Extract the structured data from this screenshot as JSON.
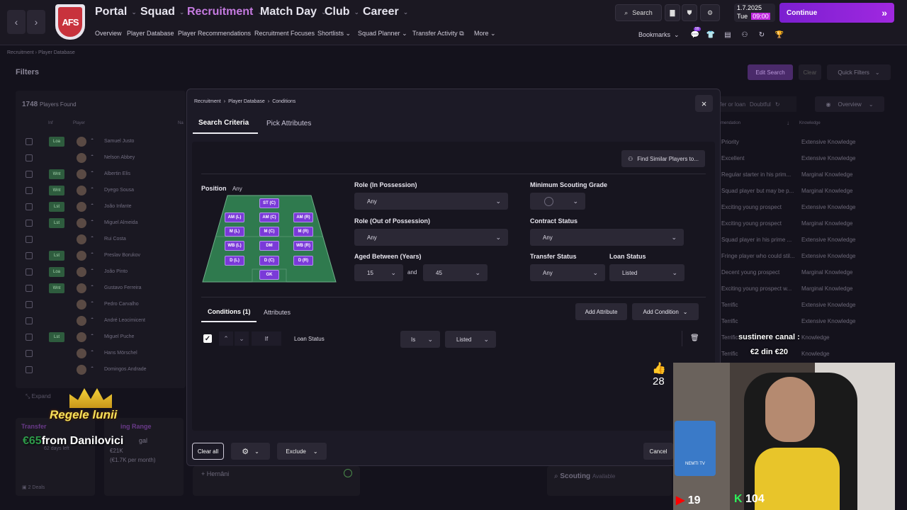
{
  "topnav": {
    "back": "‹",
    "forward": "›",
    "logo_text": "AFS",
    "items": [
      {
        "label": "Portal"
      },
      {
        "label": "Squad"
      },
      {
        "label": "Recruitment"
      },
      {
        "label": "Match Day"
      },
      {
        "label": "Club"
      },
      {
        "label": "Career"
      }
    ],
    "subitems": [
      "Overview",
      "Player Database",
      "Player Recommendations",
      "Recruitment Focuses",
      "Shortlists",
      "Squad Planner",
      "Transfer Activity",
      "More"
    ],
    "search_label": "Search",
    "date": "1.7.2025",
    "day_time": "Tue",
    "time": "09:00",
    "continue_label": "Continue",
    "bookmarks_label": "Bookmarks",
    "notif_count": "99"
  },
  "background": {
    "breadcrumb": "Recruitment  ›  Player Database",
    "filters_title": "Filters",
    "edit_search": "Edit Search",
    "clear": "Clear",
    "quick_filters": "Quick Filters",
    "players_found_count": "1748",
    "players_found_label": "Players Found",
    "col_inf": "Inf",
    "col_player": "Player",
    "col_na": "Na",
    "col_recommendation": "mendation",
    "col_knowledge": "Knowledge",
    "transfer_loan_hint": "fer or loan",
    "doubtful": "Doubtful",
    "overview_btn": "Overview",
    "expand": "Expand",
    "transfer_card_title": "Transfer",
    "transfer_card_days": "62 days left",
    "range_card_title": "ing Range",
    "range_card_value": "€21K",
    "range_card_sub": "(€1.7K per month)",
    "range_card_extra": "gal",
    "deals": "2 Deals",
    "hernani": "Hernâni",
    "scouting": "Scouting",
    "available": "Available",
    "rows": [
      {
        "tag": "Loa",
        "name": "Samuel Justo",
        "rec": "Priority",
        "know": "Extensive Knowledge"
      },
      {
        "tag": "",
        "name": "Nelson Abbey",
        "rec": "Excellent",
        "know": "Extensive Knowledge"
      },
      {
        "tag": "Wnt",
        "name": "Albertin Elis",
        "rec": "Regular starter in his prim...",
        "know": "Marginal Knowledge"
      },
      {
        "tag": "Wnt",
        "name": "Dyego Sousa",
        "rec": "Squad player but may be p...",
        "know": "Marginal Knowledge"
      },
      {
        "tag": "Lst",
        "name": "João Infante",
        "rec": "Exciting young prospect",
        "know": "Extensive Knowledge"
      },
      {
        "tag": "Lst",
        "name": "Miguel Almeida",
        "rec": "Exciting young prospect",
        "know": "Marginal Knowledge"
      },
      {
        "tag": "",
        "name": "Rui Costa",
        "rec": "Squad player in his prime ...",
        "know": "Extensive Knowledge"
      },
      {
        "tag": "Lst",
        "name": "Preslav Borukov",
        "rec": "Fringe player who could stil...",
        "know": "Extensive Knowledge"
      },
      {
        "tag": "Loa",
        "name": "João Pinto",
        "rec": "Decent young prospect",
        "know": "Marginal Knowledge"
      },
      {
        "tag": "Wnt",
        "name": "Gustavo Ferreira",
        "rec": "Exciting young prospect w...",
        "know": "Marginal Knowledge"
      },
      {
        "tag": "",
        "name": "Pedro Carvalho",
        "rec": "Terrific",
        "know": "Extensive Knowledge"
      },
      {
        "tag": "",
        "name": "André Leocimicent",
        "rec": "Terrific",
        "know": "Extensive Knowledge"
      },
      {
        "tag": "Lst",
        "name": "Miguel Puche",
        "rec": "Terrific",
        "know": "Knowledge"
      },
      {
        "tag": "",
        "name": "Hans Mörschel",
        "rec": "Terrific",
        "know": "Knowledge"
      },
      {
        "tag": "",
        "name": "Domingos Andrade",
        "rec": "Terrific",
        "know": "Extensive Knowledge"
      }
    ]
  },
  "modal": {
    "breadcrumb": [
      "Recruitment",
      "Player Database",
      "Conditions"
    ],
    "tab_search": "Search Criteria",
    "tab_attributes": "Pick Attributes",
    "find_similar": "Find Similar Players to...",
    "position_label": "Position",
    "position_value": "Any",
    "positions": [
      "ST (C)",
      "AM (L)",
      "AM (C)",
      "AM (R)",
      "M (L)",
      "M (C)",
      "M (R)",
      "WB (L)",
      "DM",
      "WB (R)",
      "D (L)",
      "D (C)",
      "D (R)",
      "GK"
    ],
    "role_in_label": "Role (In Possession)",
    "role_in_value": "Any",
    "role_out_label": "Role (Out of Possession)",
    "role_out_value": "Any",
    "aged_label": "Aged Between (Years)",
    "age_min": "15",
    "age_and": "and",
    "age_max": "45",
    "scout_grade_label": "Minimum Scouting Grade",
    "contract_label": "Contract Status",
    "contract_value": "Any",
    "transfer_label": "Transfer Status",
    "transfer_value": "Any",
    "loan_label": "Loan Status",
    "loan_value": "Listed",
    "tab_conditions": "Conditions (1)",
    "tab_cond_attributes": "Attributes",
    "add_attribute": "Add Attribute",
    "add_condition": "Add Condition",
    "cond_if": "If",
    "cond_field": "Loan Status",
    "cond_op": "Is",
    "cond_value": "Listed",
    "clear_all": "Clear all",
    "exclude": "Exclude",
    "cancel": "Cancel"
  },
  "overlay": {
    "likes": "28",
    "support_line1": "sustinere canal :",
    "support_line2": "€2 din €20",
    "king_title": "Regele lunii",
    "king_amount": "€65",
    "king_from": "from Danilovici",
    "yt_count": "19",
    "kick_count": "104",
    "card_label": "NEMTI TV"
  }
}
